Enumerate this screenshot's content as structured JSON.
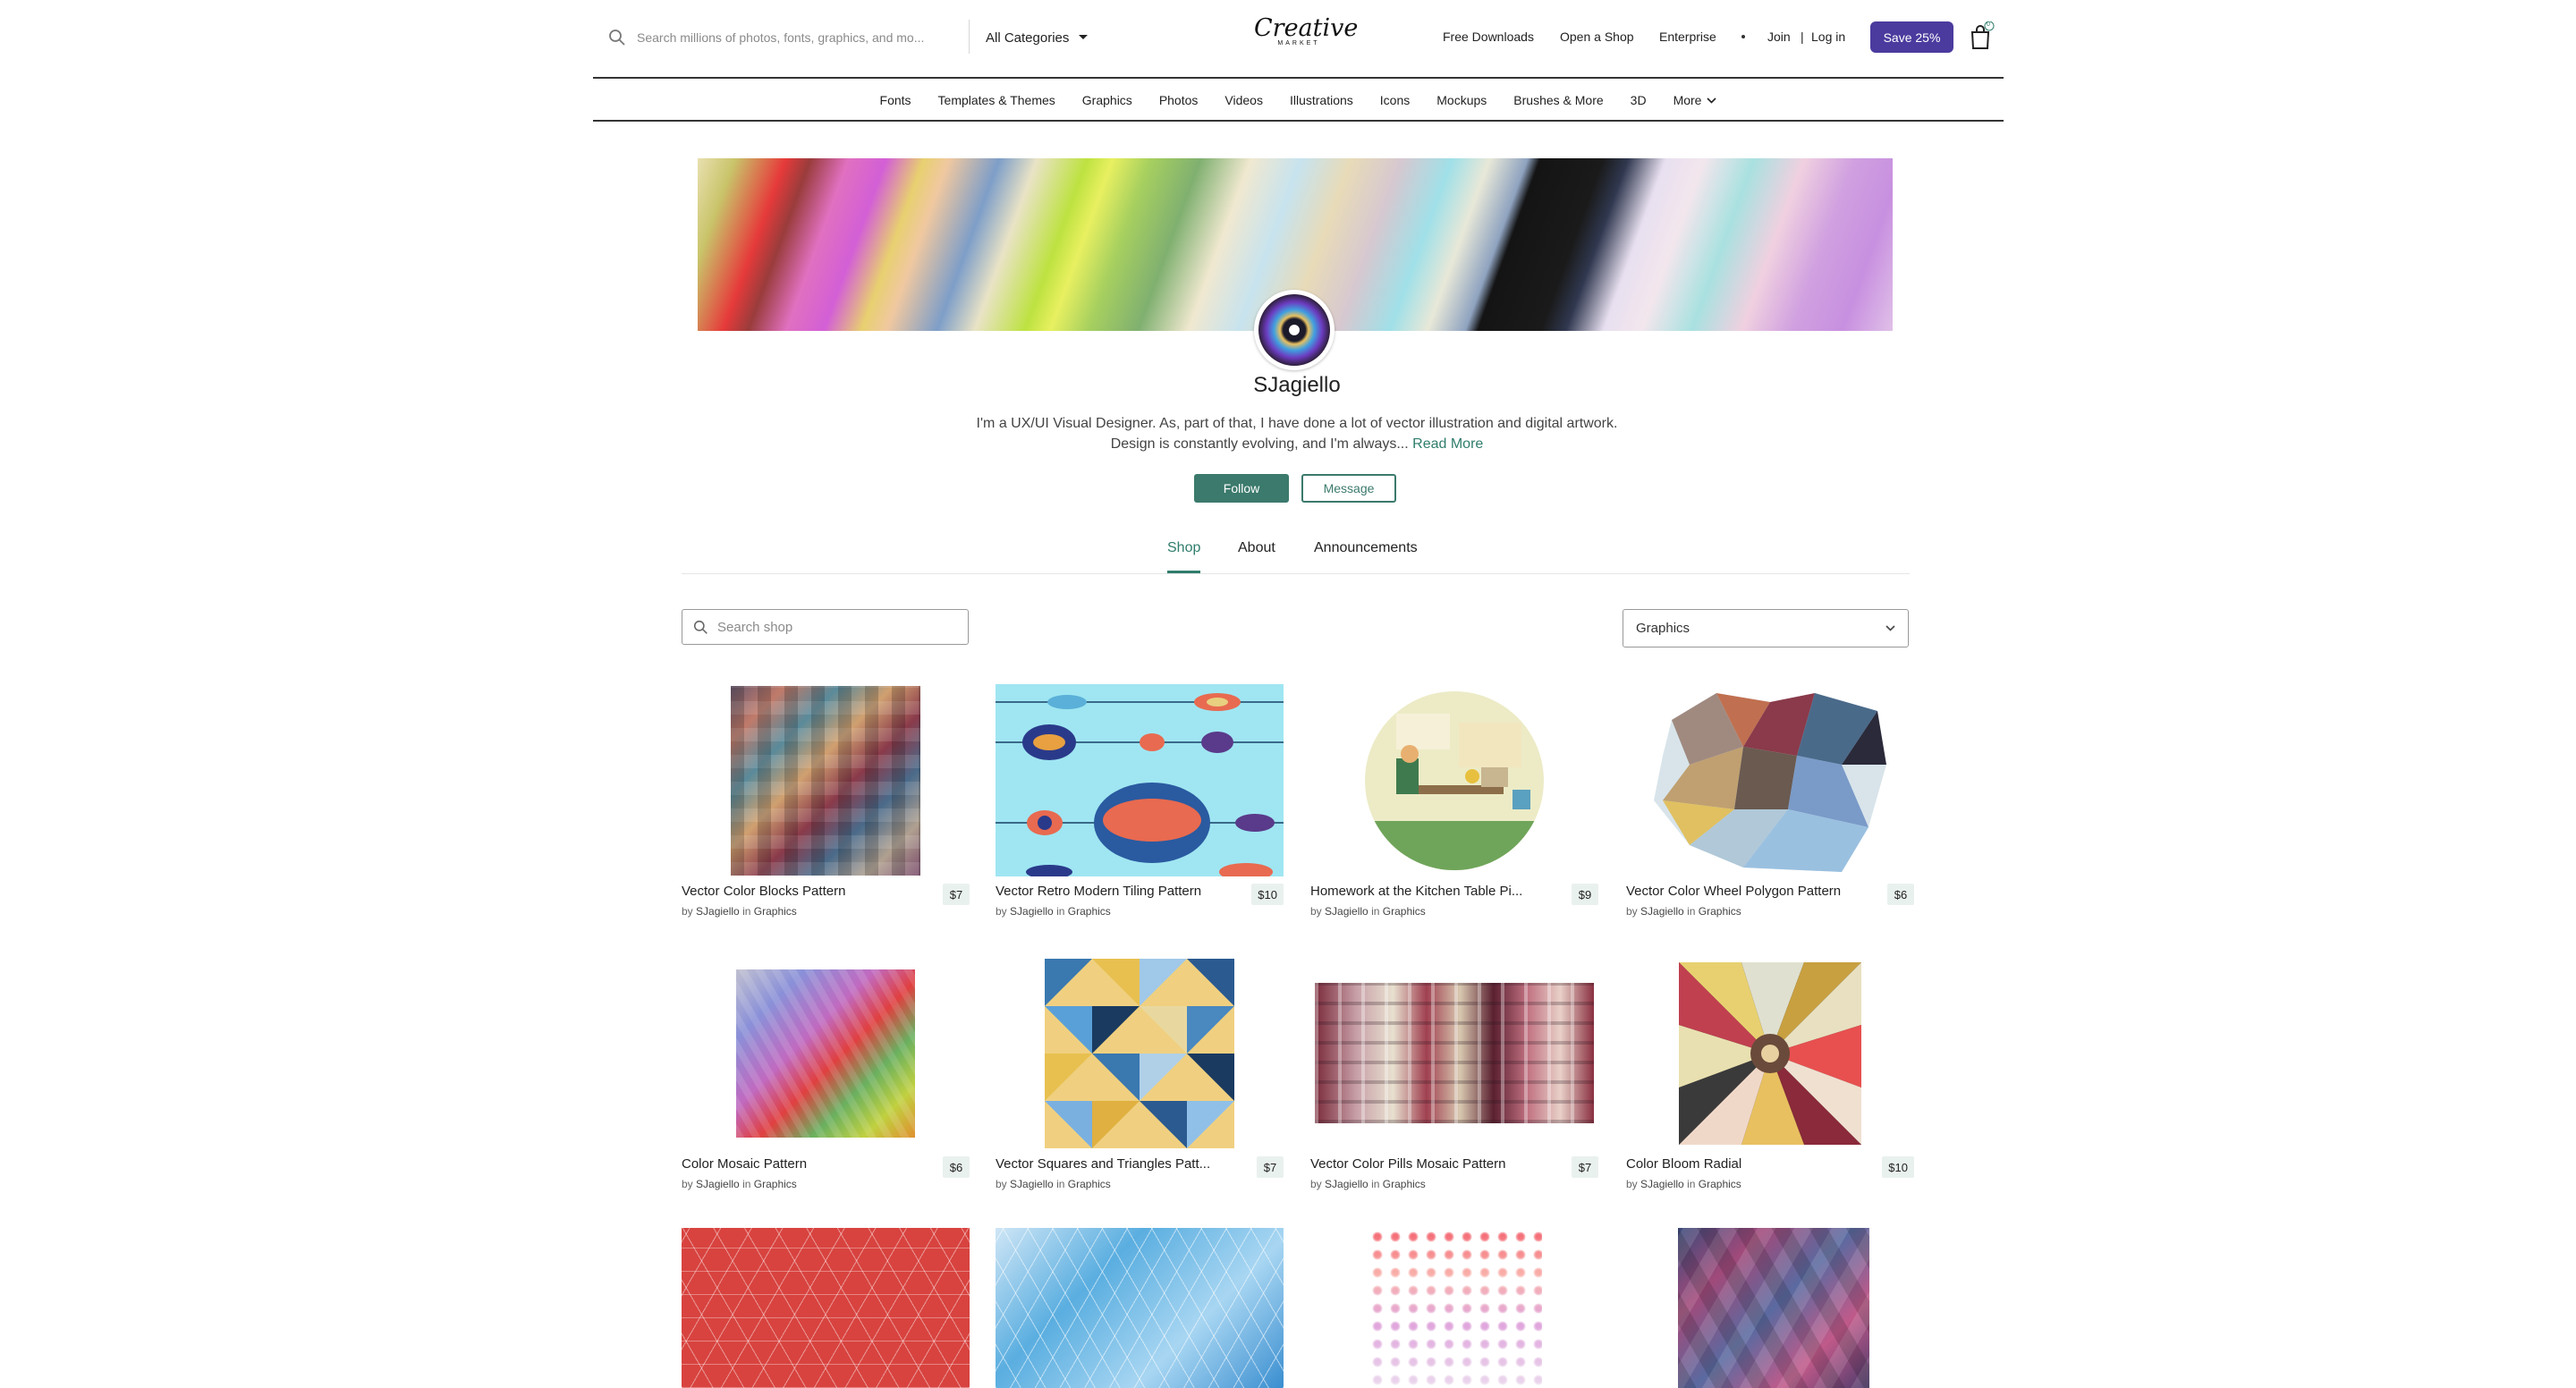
{
  "header": {
    "search_placeholder": "Search millions of photos, fonts, graphics, and mo...",
    "categories_label": "All Categories",
    "logo_text": "Creative",
    "logo_sub": "MARKET",
    "links": [
      "Free Downloads",
      "Open a Shop",
      "Enterprise"
    ],
    "join": "Join",
    "login_sep": "|",
    "login": "Log in",
    "save_label": "Save 25%",
    "cart_count": "0"
  },
  "nav": [
    "Fonts",
    "Templates & Themes",
    "Graphics",
    "Photos",
    "Videos",
    "Illustrations",
    "Icons",
    "Mockups",
    "Brushes & More",
    "3D",
    "More"
  ],
  "profile": {
    "name": "SJagiello",
    "bio": "I'm a UX/UI Visual Designer. As, part of that, I have done a lot of vector illustration and digital artwork. Design is constantly evolving, and I'm always...",
    "read_more": "Read More",
    "follow_label": "Follow",
    "message_label": "Message"
  },
  "tabs": [
    "Shop",
    "About",
    "Announcements"
  ],
  "shop": {
    "search_placeholder": "Search shop",
    "filter_value": "Graphics"
  },
  "products": [
    {
      "title": "Vector Color Blocks Pattern",
      "price": "$7",
      "by": "by",
      "author": "SJagiello",
      "in": "in",
      "category": "Graphics"
    },
    {
      "title": "Vector Retro Modern Tiling Pattern",
      "price": "$10",
      "by": "by",
      "author": "SJagiello",
      "in": "in",
      "category": "Graphics"
    },
    {
      "title": "Homework at the Kitchen Table Pi...",
      "price": "$9",
      "by": "by",
      "author": "SJagiello",
      "in": "in",
      "category": "Graphics"
    },
    {
      "title": "Vector Color Wheel Polygon Pattern",
      "price": "$6",
      "by": "by",
      "author": "SJagiello",
      "in": "in",
      "category": "Graphics"
    },
    {
      "title": "Color Mosaic Pattern",
      "price": "$6",
      "by": "by",
      "author": "SJagiello",
      "in": "in",
      "category": "Graphics"
    },
    {
      "title": "Vector Squares and Triangles Patt...",
      "price": "$7",
      "by": "by",
      "author": "SJagiello",
      "in": "in",
      "category": "Graphics"
    },
    {
      "title": "Vector Color Pills Mosaic Pattern",
      "price": "$7",
      "by": "by",
      "author": "SJagiello",
      "in": "in",
      "category": "Graphics"
    },
    {
      "title": "Color Bloom Radial",
      "price": "$10",
      "by": "by",
      "author": "SJagiello",
      "in": "in",
      "category": "Graphics"
    }
  ],
  "colors": {
    "accent": "#3b7a6c",
    "save": "#4b3b9e"
  }
}
